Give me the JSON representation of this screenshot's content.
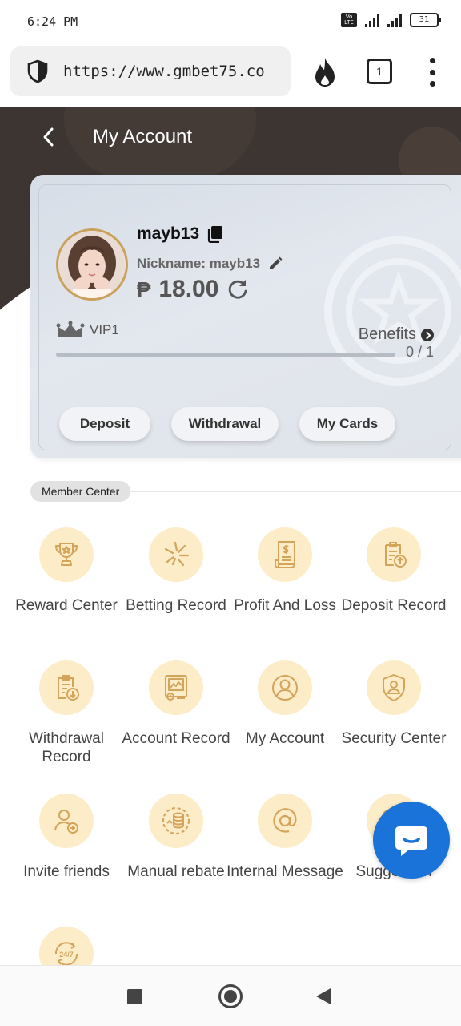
{
  "status_bar": {
    "time": "6:24 PM",
    "network": "4G",
    "volte": "Vo LTE",
    "battery": "31"
  },
  "browser": {
    "url": "https://www.gmbet75.co",
    "tab_count": "1"
  },
  "header": {
    "title": "My Account"
  },
  "account": {
    "username": "mayb13",
    "nickname": "Nickname: mayb13",
    "currency_symbol": "₱",
    "balance": "18.00",
    "vip_level": "VIP1",
    "benefits_label": "Benefits",
    "vip_progress_text": "0 / 1",
    "vip_progress_fraction": 0,
    "buttons": {
      "deposit": "Deposit",
      "withdrawal": "Withdrawal",
      "my_cards": "My Cards"
    }
  },
  "member_center": {
    "title": "Member Center",
    "items": [
      {
        "label": "Reward Center",
        "icon": "trophy-icon"
      },
      {
        "label": "Betting Record",
        "icon": "betting-icon"
      },
      {
        "label": "Profit And Loss",
        "icon": "receipt-icon"
      },
      {
        "label": "Deposit Record",
        "icon": "clipboard-upload-icon"
      },
      {
        "label": "Withdrawal Record",
        "icon": "clipboard-download-icon"
      },
      {
        "label": "Account Record",
        "icon": "account-record-icon"
      },
      {
        "label": "My Account",
        "icon": "user-circle-icon"
      },
      {
        "label": "Security Center",
        "icon": "shield-user-icon"
      },
      {
        "label": "Invite friends",
        "icon": "add-user-icon"
      },
      {
        "label": "Manual rebate",
        "icon": "coins-icon"
      },
      {
        "label": "Internal Message",
        "icon": "at-icon"
      },
      {
        "label": "Suggestion",
        "icon": "suggestion-icon"
      },
      {
        "label": "24/7",
        "icon": "support-24-7-icon"
      }
    ]
  },
  "colors": {
    "header_dark": "#3d3531",
    "accent_gold": "#c9a15a",
    "icon_circle": "#fdecc8",
    "chat_blue": "#1a73d9"
  }
}
